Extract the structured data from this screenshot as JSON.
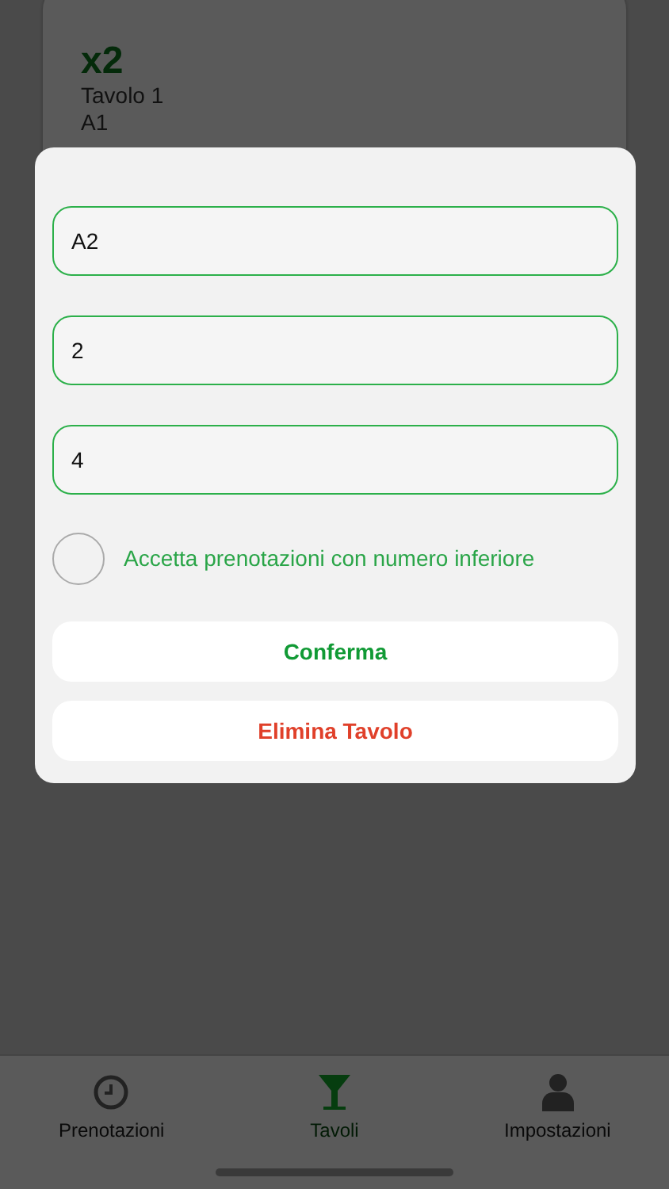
{
  "table_card": {
    "count": "x2",
    "name": "Tavolo 1",
    "code": "A1"
  },
  "dialog": {
    "fields": [
      {
        "value": "A2"
      },
      {
        "value": "2"
      },
      {
        "value": "4"
      }
    ],
    "accept_lower": {
      "label": "Accetta prenotazioni con numero inferiore",
      "checked": false
    },
    "confirm_button": "Conferma",
    "delete_button": "Elimina Tavolo"
  },
  "tabs": [
    {
      "label": "Prenotazioni",
      "kind": "clock",
      "selected": false
    },
    {
      "label": "Tavoli",
      "kind": "glass",
      "selected": true
    },
    {
      "label": "Impostazioni",
      "kind": "person",
      "selected": false
    }
  ]
}
